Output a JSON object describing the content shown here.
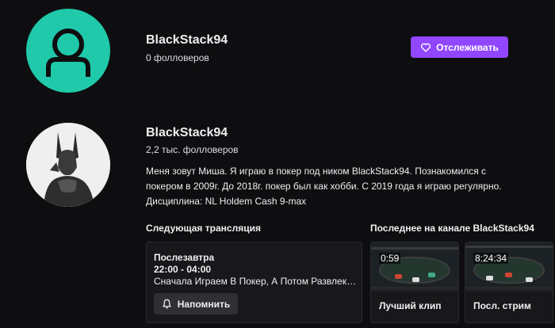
{
  "colors": {
    "background": "#0e0e10",
    "accent": "#9147ff",
    "avatar_default": "#1fc9aa",
    "card": "#18181b"
  },
  "channel_primary": {
    "name": "BlackStack94",
    "followers": "0 фолловеров",
    "follow_button_label": "Отслеживать",
    "follow_icon": "heart-icon"
  },
  "channel_detail": {
    "name": "BlackStack94",
    "followers": "2,2 тыс. фолловеров",
    "bio": "Меня зовут Миша. Я играю в покер под ником BlackStack94. Познакомился с покером в 2009г. До 2018г. покер был как хобби. С 2019 года я играю регулярно. Дисциплина: NL Holdem Cash 9-max"
  },
  "schedule": {
    "section_title": "Следующая трансляция",
    "day": "Послезавтра",
    "time": "22:00 - 04:00",
    "title": "Сначала Играем В Покер, А Потом Развлекаемся",
    "remind_label": "Напомнить",
    "remind_icon": "bell-icon"
  },
  "recent": {
    "section_title": "Последнее на канале BlackStack94",
    "videos": [
      {
        "duration": "0:59",
        "label": "Лучший клип"
      },
      {
        "duration": "8:24:34",
        "label": "Посл. стрим"
      }
    ]
  }
}
